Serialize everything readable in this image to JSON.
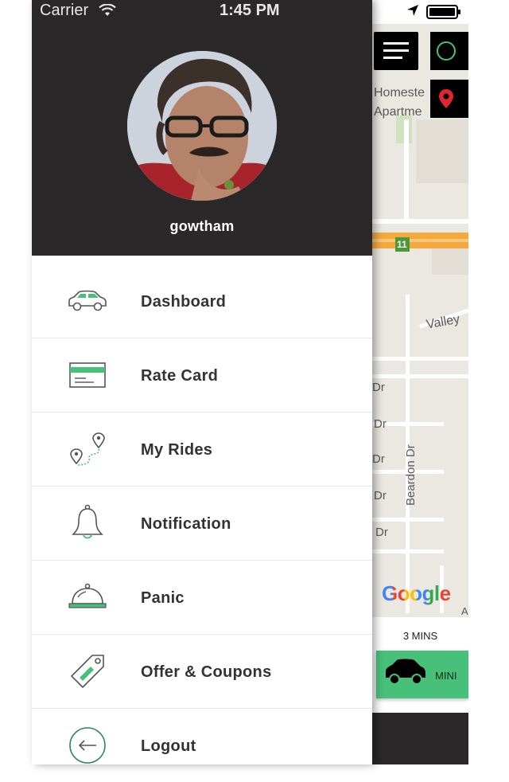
{
  "status_bar": {
    "carrier": "Carrier",
    "time": "1:45 PM"
  },
  "drawer": {
    "username": "gowtham",
    "menu": [
      {
        "label": "Dashboard",
        "icon": "car-icon"
      },
      {
        "label": "Rate Card",
        "icon": "card-icon"
      },
      {
        "label": "My Rides",
        "icon": "route-icon"
      },
      {
        "label": "Notification",
        "icon": "bell-icon"
      },
      {
        "label": "Panic",
        "icon": "service-bell-icon"
      },
      {
        "label": "Offer & Coupons",
        "icon": "tag-icon"
      },
      {
        "label": "Logout",
        "icon": "logout-icon"
      }
    ]
  },
  "map": {
    "labels": {
      "homestead": "Homeste",
      "apartments": "Apartme",
      "route": "11",
      "valley": "Valley",
      "beardon": "Beardon Dr",
      "dr1": "Dr",
      "dr2": "Dr",
      "dr3": "Dr",
      "dr4": "Dr",
      "dr5": "Dr",
      "attribution": "Google",
      "edge": "A"
    },
    "eta": "3 MINS",
    "ride_type": "MINI"
  },
  "colors": {
    "accent_green": "#47c07a",
    "header_dark": "#2a2829",
    "pin_red": "#e0262f"
  }
}
